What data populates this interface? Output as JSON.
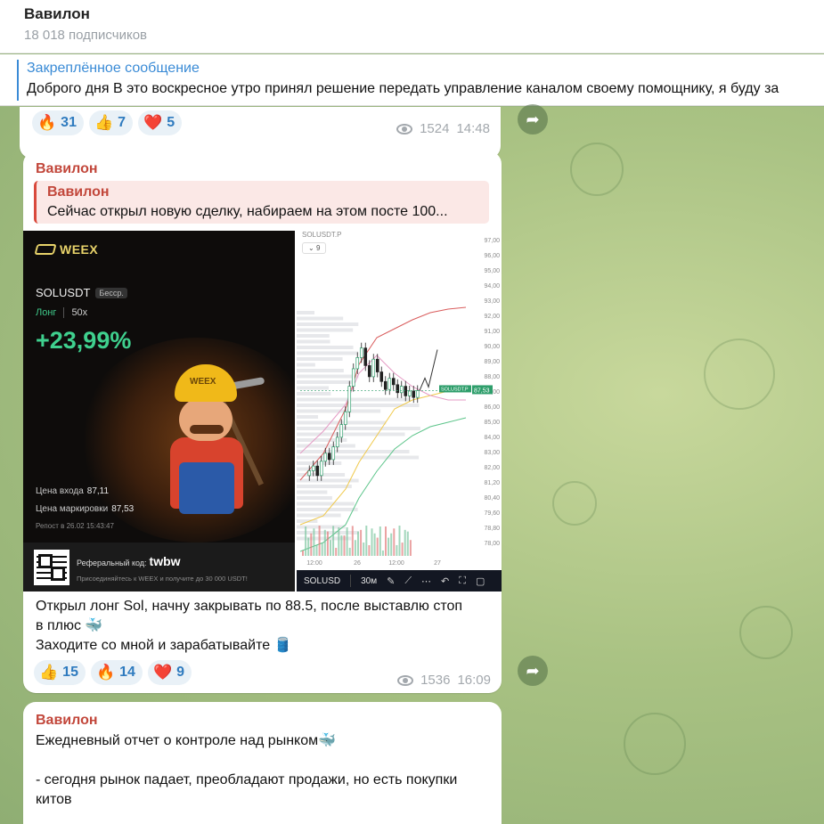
{
  "channel": {
    "name": "Вавилон",
    "subscribers": "18 018 подписчиков"
  },
  "pinned": {
    "label": "Закреплённое сообщение",
    "text": "Доброго дня  В это воскресное утро принял решение передать управление каналом своему помощнику, я буду за"
  },
  "messages": [
    {
      "reactions": [
        {
          "emoji": "🔥",
          "count": "31"
        },
        {
          "emoji": "👍",
          "count": "7"
        },
        {
          "emoji": "❤️",
          "count": "5"
        }
      ],
      "views": "1524",
      "time": "14:48"
    },
    {
      "author": "Вавилон",
      "reply": {
        "author": "Вавилон",
        "text": "Сейчас открыл новую сделку, набираем на этом посте 100..."
      },
      "card": {
        "logo": "WEEX",
        "pair": "SOLUSDT",
        "pair_tag": "Бесср.",
        "side": "Лонг",
        "leverage": "50x",
        "pnl": "+23,99%",
        "helmet_text": "WEEX",
        "entry_label": "Цена входа",
        "entry_value": "87,11",
        "mark_label": "Цена маркировки",
        "mark_value": "87,53",
        "repost": "Репост в 26.02 15:43:47",
        "ref_label": "Реферальный код:",
        "ref_code": "twbw",
        "ref_sub": "Присоединяйтесь к WEEX и получите до 30 000 USDT!"
      },
      "chart": {
        "symbol": "SOLUSDT.P",
        "timeframe": "9",
        "price_tag": "87,53",
        "price_tag_label": "SOLUSDT.P",
        "y_ticks": [
          "97,00",
          "96,00",
          "95,00",
          "94,00",
          "93,00",
          "92,00",
          "91,00",
          "90,00",
          "89,00",
          "88,00",
          "87,00",
          "86,00",
          "85,00",
          "84,00",
          "83,00",
          "82,00",
          "81,20",
          "80,40",
          "79,60",
          "78,80",
          "78,00"
        ],
        "x_ticks": [
          "12:00",
          "26",
          "12:00",
          "27"
        ],
        "bottom_symbol": "SOLUSD",
        "bottom_tf": "30м",
        "candles": [
          82.5,
          82.8,
          82.2,
          83.1,
          83.6,
          83.2,
          84.0,
          84.6,
          85.4,
          86.2,
          87.8,
          88.9,
          89.6,
          90.2,
          89.1,
          88.4,
          89.5,
          88.7,
          88.1,
          87.6,
          88.3,
          87.9,
          87.4,
          87.8,
          87.2,
          87.5,
          87.1,
          87.53
        ]
      },
      "text_lines": [
        "Открыл лонг Sol, начну закрывать по 88.5, после выставлю стоп",
        "в плюс 🐳",
        "Заходите со мной и зарабатывайте 🛢️"
      ],
      "reactions": [
        {
          "emoji": "👍",
          "count": "15"
        },
        {
          "emoji": "🔥",
          "count": "14"
        },
        {
          "emoji": "❤️",
          "count": "9"
        }
      ],
      "views": "1536",
      "time": "16:09"
    },
    {
      "author": "Вавилон",
      "text_lines": [
        "Ежедневный отчет о контроле над рынком🐳",
        "",
        "- сегодня рынок падает, преобладают продажи, но есть покупки",
        "китов"
      ]
    }
  ],
  "colors": {
    "link_blue": "#3a8bd6",
    "author_red": "#c2473b",
    "pnl_green": "#3fd08e",
    "reaction_bg": "#e9f1f7"
  }
}
